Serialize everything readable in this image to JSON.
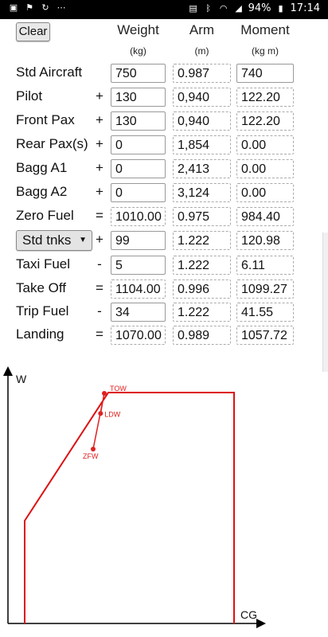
{
  "status_bar": {
    "battery": "94%",
    "time": "17:14"
  },
  "toolbar": {
    "clear_label": "Clear"
  },
  "headers": {
    "weight": "Weight",
    "arm": "Arm",
    "moment": "Moment",
    "weight_unit": "(kg)",
    "arm_unit": "(m)",
    "moment_unit": "(kg m)"
  },
  "rows": [
    {
      "label": "Std Aircraft",
      "op": "",
      "weight": "750",
      "arm": "0.987",
      "moment": "740"
    },
    {
      "label": "Pilot",
      "op": "+",
      "weight": "130",
      "arm": "0,940",
      "moment": "122.20"
    },
    {
      "label": "Front Pax",
      "op": "+",
      "weight": "130",
      "arm": "0,940",
      "moment": "122.20"
    },
    {
      "label": "Rear Pax(s)",
      "op": "+",
      "weight": "0",
      "arm": "1,854",
      "moment": "0.00"
    },
    {
      "label": "Bagg A1",
      "op": "+",
      "weight": "0",
      "arm": "2,413",
      "moment": "0.00"
    },
    {
      "label": "Bagg A2",
      "op": "+",
      "weight": "0",
      "arm": "3,124",
      "moment": "0.00"
    },
    {
      "label": "Zero Fuel",
      "op": "=",
      "weight": "1010.00",
      "arm": "0.975",
      "moment": "984.40"
    },
    {
      "label": "Std tnks",
      "op": "+",
      "weight": "99",
      "arm": "1.222",
      "moment": "120.98"
    },
    {
      "label": "Taxi Fuel",
      "op": "-",
      "weight": "5",
      "arm": "1.222",
      "moment": "6.11"
    },
    {
      "label": "Take Off",
      "op": "=",
      "weight": "1104.00",
      "arm": "0.996",
      "moment": "1099.27"
    },
    {
      "label": "Trip Fuel",
      "op": "-",
      "weight": "34",
      "arm": "1.222",
      "moment": "41.55"
    },
    {
      "label": "Landing",
      "op": "=",
      "weight": "1070.00",
      "arm": "0.989",
      "moment": "1057.72"
    }
  ],
  "envelope_chart": {
    "y_axis_label": "W",
    "x_axis_label": "CG",
    "points": [
      {
        "label": "TOW",
        "arm": 0.996,
        "weight": 1104.0
      },
      {
        "label": "LDW",
        "arm": 0.989,
        "weight": 1070.0
      },
      {
        "label": "ZFW",
        "arm": 0.975,
        "weight": 1010.0
      }
    ],
    "envelope_color": "#dd1111",
    "point_color": "#e02020"
  }
}
